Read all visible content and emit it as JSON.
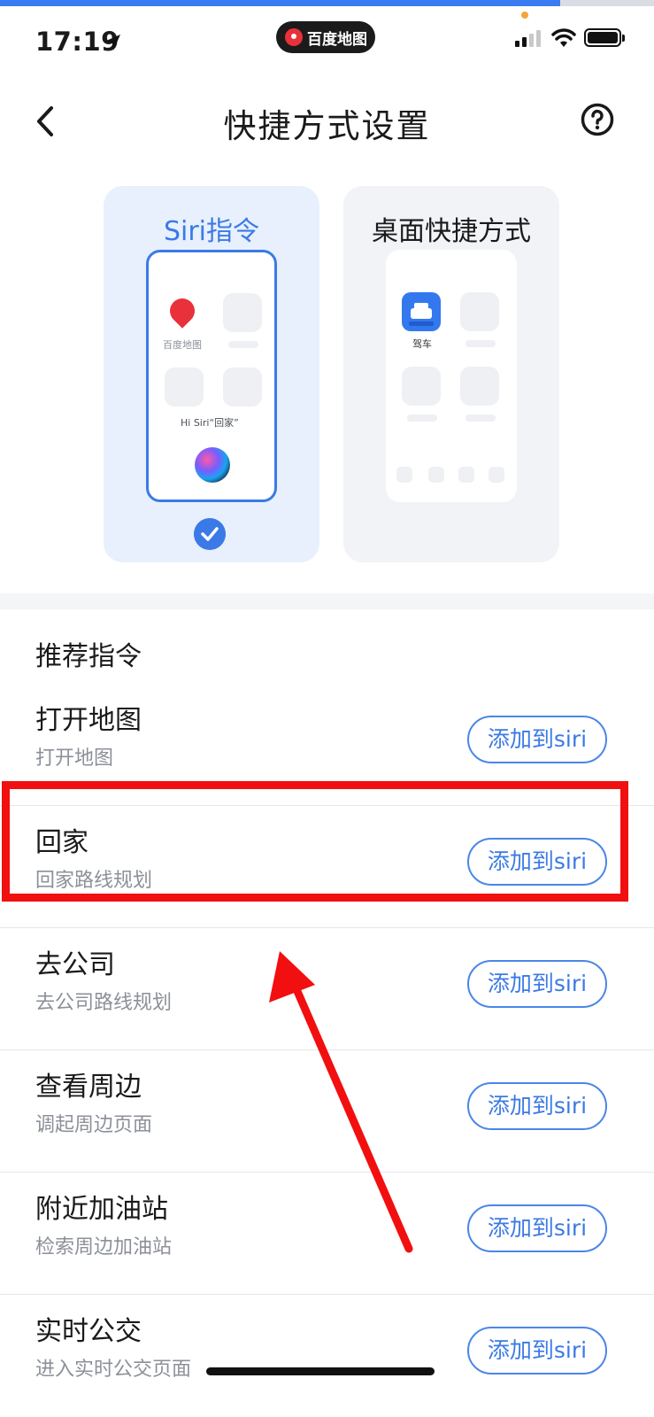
{
  "progress": {
    "fraction": 0.857,
    "accent": "#3a7bf2"
  },
  "status_bar": {
    "time": "17:19",
    "app_pill_label": "百度地图",
    "icons": [
      "location-arrow-icon",
      "cellular-signal-icon",
      "wifi-icon",
      "battery-icon"
    ]
  },
  "header": {
    "title": "快捷方式设置",
    "back_icon": "chevron-left-icon",
    "help_icon": "question-circle-icon"
  },
  "cards": {
    "siri": {
      "title": "Siri指令",
      "selected": true,
      "app_label": "百度地图",
      "hint": "Hi Siri“回家”",
      "accent": "#3b7ae6"
    },
    "desktop": {
      "title": "桌面快捷方式",
      "selected": false,
      "app_label": "驾车"
    }
  },
  "section": {
    "title": "推荐指令"
  },
  "commands": [
    {
      "title": "打开地图",
      "subtitle": "打开地图",
      "button": "添加到siri"
    },
    {
      "title": "回家",
      "subtitle": "回家路线规划",
      "button": "添加到siri"
    },
    {
      "title": "去公司",
      "subtitle": "去公司路线规划",
      "button": "添加到siri"
    },
    {
      "title": "查看周边",
      "subtitle": "调起周边页面",
      "button": "添加到siri"
    },
    {
      "title": "附近加油站",
      "subtitle": "检索周边加油站",
      "button": "添加到siri"
    },
    {
      "title": "实时公交",
      "subtitle": "进入实时公交页面",
      "button": "添加到siri"
    }
  ],
  "annotation": {
    "color": "#f20f0f",
    "highlighted_row": "回家"
  }
}
